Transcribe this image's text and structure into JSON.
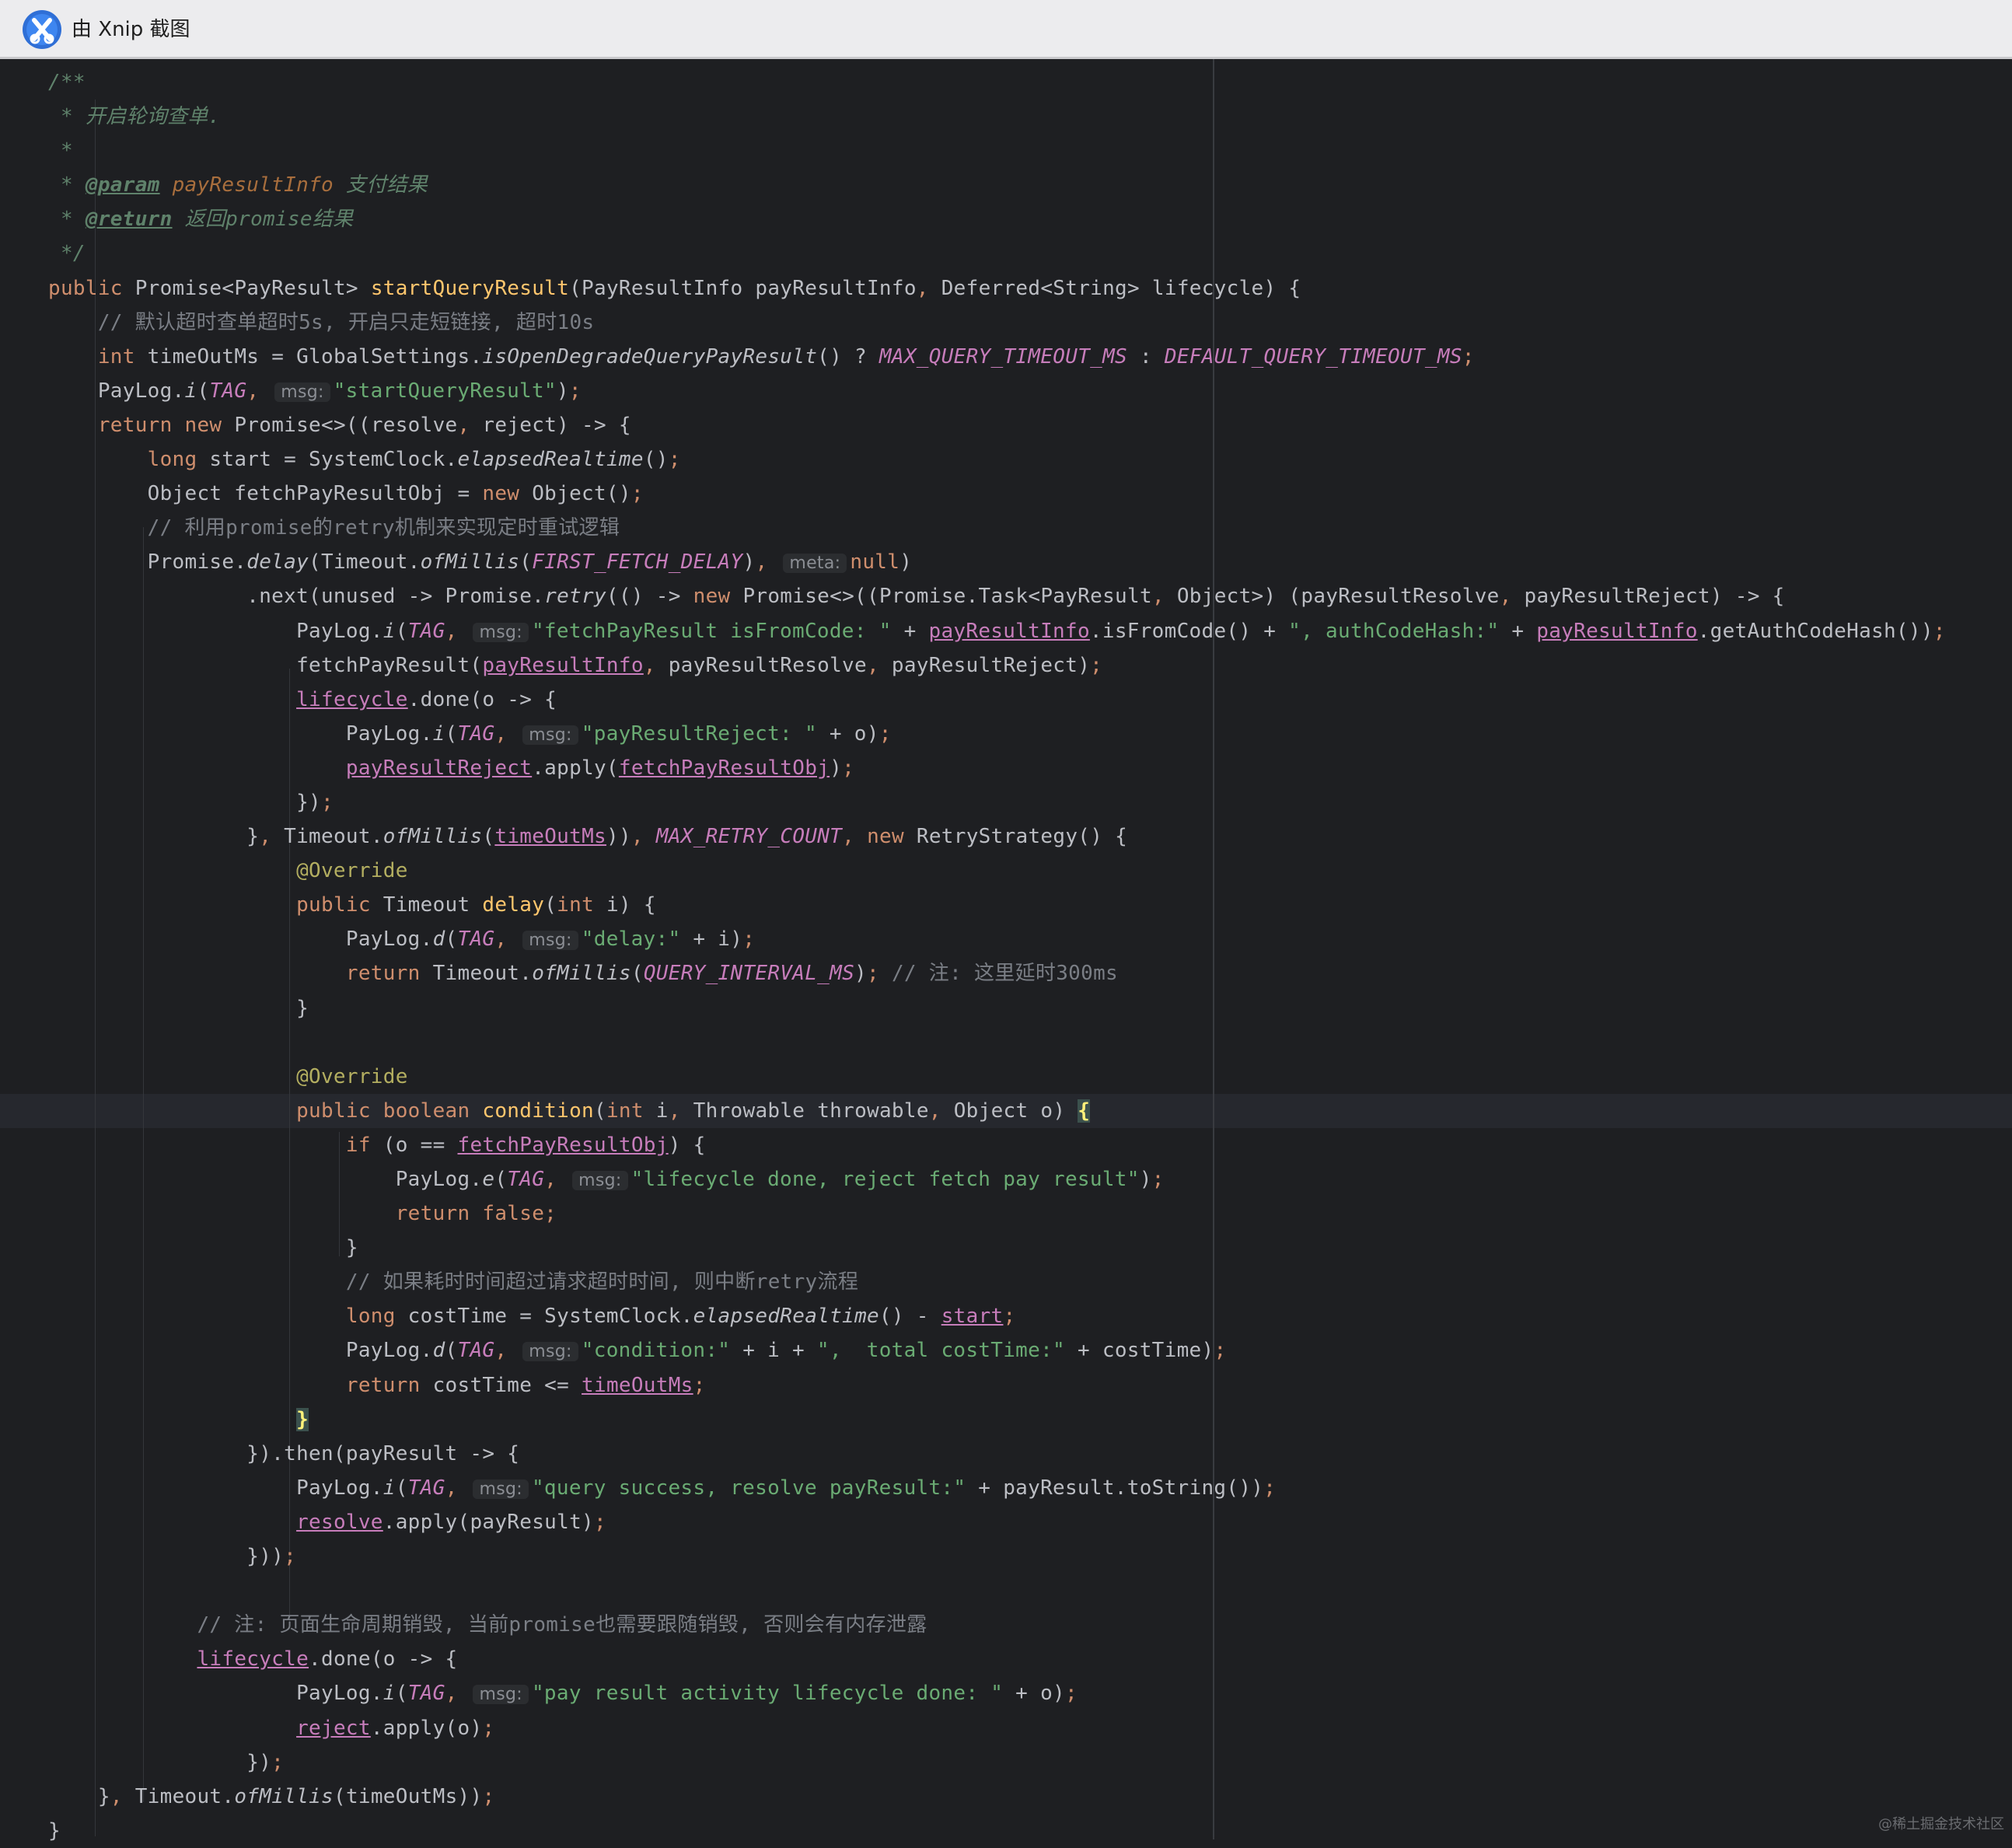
{
  "window": {
    "title": "由 Xnip 截图"
  },
  "watermark": "@稀土掘金技术社区",
  "colors": {
    "keyword": "#cf8e6d",
    "method_decl": "#ffc66d",
    "string": "#6aab73",
    "comment": "#7a7e85",
    "javadoc": "#5f826b",
    "constant": "#c77dbb",
    "annotation": "#b3ae60",
    "default_text": "#bcbec4",
    "background": "#1e1f22"
  },
  "editor": {
    "current_line_index": 30,
    "lines": [
      [
        [
          "dc",
          "/**"
        ]
      ],
      [
        [
          "dc",
          " * 开启轮询查单."
        ]
      ],
      [
        [
          "dc",
          " *"
        ]
      ],
      [
        [
          "dc",
          " * "
        ],
        [
          "dt",
          "@param"
        ],
        [
          "dc",
          " "
        ],
        [
          "dp",
          "payResultInfo"
        ],
        [
          "dc",
          " 支付结果"
        ]
      ],
      [
        [
          "dc",
          " * "
        ],
        [
          "dt",
          "@return"
        ],
        [
          "dc",
          " 返回promise结果"
        ]
      ],
      [
        [
          "dc",
          " */"
        ]
      ],
      [
        [
          "kw",
          "public "
        ],
        [
          "t",
          "Promise<PayResult> "
        ],
        [
          "fd",
          "startQueryResult"
        ],
        [
          "t",
          "(PayResultInfo payResultInfo"
        ],
        [
          "pn",
          ", "
        ],
        [
          "t",
          "Deferred<String> lifecycle) {"
        ]
      ],
      [
        [
          "cm",
          "    // 默认超时查单超时5s, 开启只走短链接, 超时10s"
        ]
      ],
      [
        [
          "t",
          "    "
        ],
        [
          "kw",
          "int "
        ],
        [
          "t",
          "timeOutMs = GlobalSettings."
        ],
        [
          "it",
          "isOpenDegradeQueryPayResult"
        ],
        [
          "t",
          "() ? "
        ],
        [
          "cn",
          "MAX_QUERY_TIMEOUT_MS"
        ],
        [
          "t",
          " : "
        ],
        [
          "cn",
          "DEFAULT_QUERY_TIMEOUT_MS"
        ],
        [
          "pn",
          ";"
        ]
      ],
      [
        [
          "t",
          "    PayLog."
        ],
        [
          "it",
          "i"
        ],
        [
          "t",
          "("
        ],
        [
          "cn",
          "TAG"
        ],
        [
          "pn",
          ", "
        ],
        [
          "hint",
          "msg:"
        ],
        [
          "st",
          "\"startQueryResult\""
        ],
        [
          "t",
          ")"
        ],
        [
          "pn",
          ";"
        ]
      ],
      [
        [
          "t",
          "    "
        ],
        [
          "kw",
          "return new "
        ],
        [
          "t",
          "Promise<>((resolve"
        ],
        [
          "pn",
          ", "
        ],
        [
          "t",
          "reject) -> {"
        ]
      ],
      [
        [
          "t",
          "        "
        ],
        [
          "kw",
          "long "
        ],
        [
          "t",
          "start = SystemClock."
        ],
        [
          "it",
          "elapsedRealtime"
        ],
        [
          "t",
          "()"
        ],
        [
          "pn",
          ";"
        ]
      ],
      [
        [
          "t",
          "        Object fetchPayResultObj = "
        ],
        [
          "kw",
          "new "
        ],
        [
          "t",
          "Object()"
        ],
        [
          "pn",
          ";"
        ]
      ],
      [
        [
          "cm",
          "        // 利用promise的retry机制来实现定时重试逻辑"
        ]
      ],
      [
        [
          "t",
          "        Promise."
        ],
        [
          "it",
          "delay"
        ],
        [
          "t",
          "(Timeout."
        ],
        [
          "it",
          "ofMillis"
        ],
        [
          "t",
          "("
        ],
        [
          "cn",
          "FIRST_FETCH_DELAY"
        ],
        [
          "t",
          ")"
        ],
        [
          "pn",
          ", "
        ],
        [
          "hint",
          "meta:"
        ],
        [
          "kw",
          "null"
        ],
        [
          "t",
          ")"
        ]
      ],
      [
        [
          "t",
          "                .next(unused -> Promise."
        ],
        [
          "it",
          "retry"
        ],
        [
          "t",
          "(() -> "
        ],
        [
          "kw",
          "new "
        ],
        [
          "t",
          "Promise<>((Promise.Task<PayResult"
        ],
        [
          "pn",
          ", "
        ],
        [
          "t",
          "Object>) (payResultResolve"
        ],
        [
          "pn",
          ", "
        ],
        [
          "t",
          "payResultReject) -> {"
        ]
      ],
      [
        [
          "t",
          "                    PayLog."
        ],
        [
          "it",
          "i"
        ],
        [
          "t",
          "("
        ],
        [
          "cn",
          "TAG"
        ],
        [
          "pn",
          ", "
        ],
        [
          "hint",
          "msg:"
        ],
        [
          "st",
          "\"fetchPayResult isFromCode: \""
        ],
        [
          "t",
          " + "
        ],
        [
          "ul",
          "payResultInfo"
        ],
        [
          "t",
          ".isFromCode() + "
        ],
        [
          "st",
          "\", authCodeHash:\""
        ],
        [
          "t",
          " + "
        ],
        [
          "ul",
          "payResultInfo"
        ],
        [
          "t",
          ".getAuthCodeHash())"
        ],
        [
          "pn",
          ";"
        ]
      ],
      [
        [
          "t",
          "                    fetchPayResult("
        ],
        [
          "ul",
          "payResultInfo"
        ],
        [
          "pn",
          ", "
        ],
        [
          "t",
          "payResultResolve"
        ],
        [
          "pn",
          ", "
        ],
        [
          "t",
          "payResultReject)"
        ],
        [
          "pn",
          ";"
        ]
      ],
      [
        [
          "t",
          "                    "
        ],
        [
          "ul",
          "lifecycle"
        ],
        [
          "t",
          ".done(o -> {"
        ]
      ],
      [
        [
          "t",
          "                        PayLog."
        ],
        [
          "it",
          "i"
        ],
        [
          "t",
          "("
        ],
        [
          "cn",
          "TAG"
        ],
        [
          "pn",
          ", "
        ],
        [
          "hint",
          "msg:"
        ],
        [
          "st",
          "\"payResultReject: \""
        ],
        [
          "t",
          " + o)"
        ],
        [
          "pn",
          ";"
        ]
      ],
      [
        [
          "t",
          "                        "
        ],
        [
          "ul",
          "payResultReject"
        ],
        [
          "t",
          ".apply("
        ],
        [
          "ul",
          "fetchPayResultObj"
        ],
        [
          "t",
          ")"
        ],
        [
          "pn",
          ";"
        ]
      ],
      [
        [
          "t",
          "                    })"
        ],
        [
          "pn",
          ";"
        ]
      ],
      [
        [
          "t",
          "                }"
        ],
        [
          "pn",
          ", "
        ],
        [
          "t",
          "Timeout."
        ],
        [
          "it",
          "ofMillis"
        ],
        [
          "t",
          "("
        ],
        [
          "ul",
          "timeOutMs"
        ],
        [
          "t",
          "))"
        ],
        [
          "pn",
          ", "
        ],
        [
          "cn",
          "MAX_RETRY_COUNT"
        ],
        [
          "pn",
          ", "
        ],
        [
          "kw",
          "new "
        ],
        [
          "t",
          "RetryStrategy() {"
        ]
      ],
      [
        [
          "an",
          "                    @Override"
        ]
      ],
      [
        [
          "t",
          "                    "
        ],
        [
          "kw",
          "public "
        ],
        [
          "t",
          "Timeout "
        ],
        [
          "fd",
          "delay"
        ],
        [
          "t",
          "("
        ],
        [
          "kw",
          "int "
        ],
        [
          "t",
          "i) {"
        ]
      ],
      [
        [
          "t",
          "                        PayLog."
        ],
        [
          "it",
          "d"
        ],
        [
          "t",
          "("
        ],
        [
          "cn",
          "TAG"
        ],
        [
          "pn",
          ", "
        ],
        [
          "hint",
          "msg:"
        ],
        [
          "st",
          "\"delay:\""
        ],
        [
          "t",
          " + i)"
        ],
        [
          "pn",
          ";"
        ]
      ],
      [
        [
          "t",
          "                        "
        ],
        [
          "kw",
          "return "
        ],
        [
          "t",
          "Timeout."
        ],
        [
          "it",
          "ofMillis"
        ],
        [
          "t",
          "("
        ],
        [
          "cn",
          "QUERY_INTERVAL_MS"
        ],
        [
          "t",
          ")"
        ],
        [
          "pn",
          "; "
        ],
        [
          "cm",
          "// 注: 这里延时300ms"
        ]
      ],
      [
        [
          "t",
          "                    }"
        ]
      ],
      [
        [
          "t",
          ""
        ]
      ],
      [
        [
          "an",
          "                    @Override"
        ]
      ],
      [
        [
          "t",
          "                    "
        ],
        [
          "kw",
          "public boolean "
        ],
        [
          "fd",
          "condition"
        ],
        [
          "t",
          "("
        ],
        [
          "kw",
          "int "
        ],
        [
          "t",
          "i"
        ],
        [
          "pn",
          ", "
        ],
        [
          "t",
          "Throwable throwable"
        ],
        [
          "pn",
          ", "
        ],
        [
          "t",
          "Object o) "
        ],
        [
          "br",
          "{"
        ]
      ],
      [
        [
          "t",
          "                        "
        ],
        [
          "kw",
          "if "
        ],
        [
          "t",
          "(o == "
        ],
        [
          "ul",
          "fetchPayResultObj"
        ],
        [
          "t",
          ") {"
        ]
      ],
      [
        [
          "t",
          "                            PayLog."
        ],
        [
          "it",
          "e"
        ],
        [
          "t",
          "("
        ],
        [
          "cn",
          "TAG"
        ],
        [
          "pn",
          ", "
        ],
        [
          "hint",
          "msg:"
        ],
        [
          "st",
          "\"lifecycle done, reject fetch pay result\""
        ],
        [
          "t",
          ")"
        ],
        [
          "pn",
          ";"
        ]
      ],
      [
        [
          "t",
          "                            "
        ],
        [
          "kw",
          "return false"
        ],
        [
          "pn",
          ";"
        ]
      ],
      [
        [
          "t",
          "                        }"
        ]
      ],
      [
        [
          "cm",
          "                        // 如果耗时时间超过请求超时时间, 则中断retry流程"
        ]
      ],
      [
        [
          "t",
          "                        "
        ],
        [
          "kw",
          "long "
        ],
        [
          "t",
          "costTime = SystemClock."
        ],
        [
          "it",
          "elapsedRealtime"
        ],
        [
          "t",
          "() - "
        ],
        [
          "ul",
          "start"
        ],
        [
          "pn",
          ";"
        ]
      ],
      [
        [
          "t",
          "                        PayLog."
        ],
        [
          "it",
          "d"
        ],
        [
          "t",
          "("
        ],
        [
          "cn",
          "TAG"
        ],
        [
          "pn",
          ", "
        ],
        [
          "hint",
          "msg:"
        ],
        [
          "st",
          "\"condition:\""
        ],
        [
          "t",
          " + i + "
        ],
        [
          "st",
          "\",  total costTime:\""
        ],
        [
          "t",
          " + costTime)"
        ],
        [
          "pn",
          ";"
        ]
      ],
      [
        [
          "t",
          "                        "
        ],
        [
          "kw",
          "return "
        ],
        [
          "t",
          "costTime <= "
        ],
        [
          "ul",
          "timeOutMs"
        ],
        [
          "pn",
          ";"
        ]
      ],
      [
        [
          "t",
          "                    "
        ],
        [
          "br",
          "}"
        ]
      ],
      [
        [
          "t",
          "                }).then(payResult -> {"
        ]
      ],
      [
        [
          "t",
          "                    PayLog."
        ],
        [
          "it",
          "i"
        ],
        [
          "t",
          "("
        ],
        [
          "cn",
          "TAG"
        ],
        [
          "pn",
          ", "
        ],
        [
          "hint",
          "msg:"
        ],
        [
          "st",
          "\"query success, resolve payResult:\""
        ],
        [
          "t",
          " + payResult.toString())"
        ],
        [
          "pn",
          ";"
        ]
      ],
      [
        [
          "t",
          "                    "
        ],
        [
          "ul",
          "resolve"
        ],
        [
          "t",
          ".apply(payResult)"
        ],
        [
          "pn",
          ";"
        ]
      ],
      [
        [
          "t",
          "                }))"
        ],
        [
          "pn",
          ";"
        ]
      ],
      [
        [
          "t",
          ""
        ]
      ],
      [
        [
          "cm",
          "            // 注: 页面生命周期销毁, 当前promise也需要跟随销毁, 否则会有内存泄露"
        ]
      ],
      [
        [
          "t",
          "            "
        ],
        [
          "ul",
          "lifecycle"
        ],
        [
          "t",
          ".done(o -> {"
        ]
      ],
      [
        [
          "t",
          "                    PayLog."
        ],
        [
          "it",
          "i"
        ],
        [
          "t",
          "("
        ],
        [
          "cn",
          "TAG"
        ],
        [
          "pn",
          ", "
        ],
        [
          "hint",
          "msg:"
        ],
        [
          "st",
          "\"pay result activity lifecycle done: \""
        ],
        [
          "t",
          " + o)"
        ],
        [
          "pn",
          ";"
        ]
      ],
      [
        [
          "t",
          "                    "
        ],
        [
          "ul",
          "reject"
        ],
        [
          "t",
          ".apply(o)"
        ],
        [
          "pn",
          ";"
        ]
      ],
      [
        [
          "t",
          "                })"
        ],
        [
          "pn",
          ";"
        ]
      ],
      [
        [
          "t",
          "    }"
        ],
        [
          "pn",
          ", "
        ],
        [
          "t",
          "Timeout."
        ],
        [
          "it",
          "ofMillis"
        ],
        [
          "t",
          "(timeOutMs))"
        ],
        [
          "pn",
          ";"
        ]
      ],
      [
        [
          "t",
          "}"
        ]
      ]
    ]
  }
}
